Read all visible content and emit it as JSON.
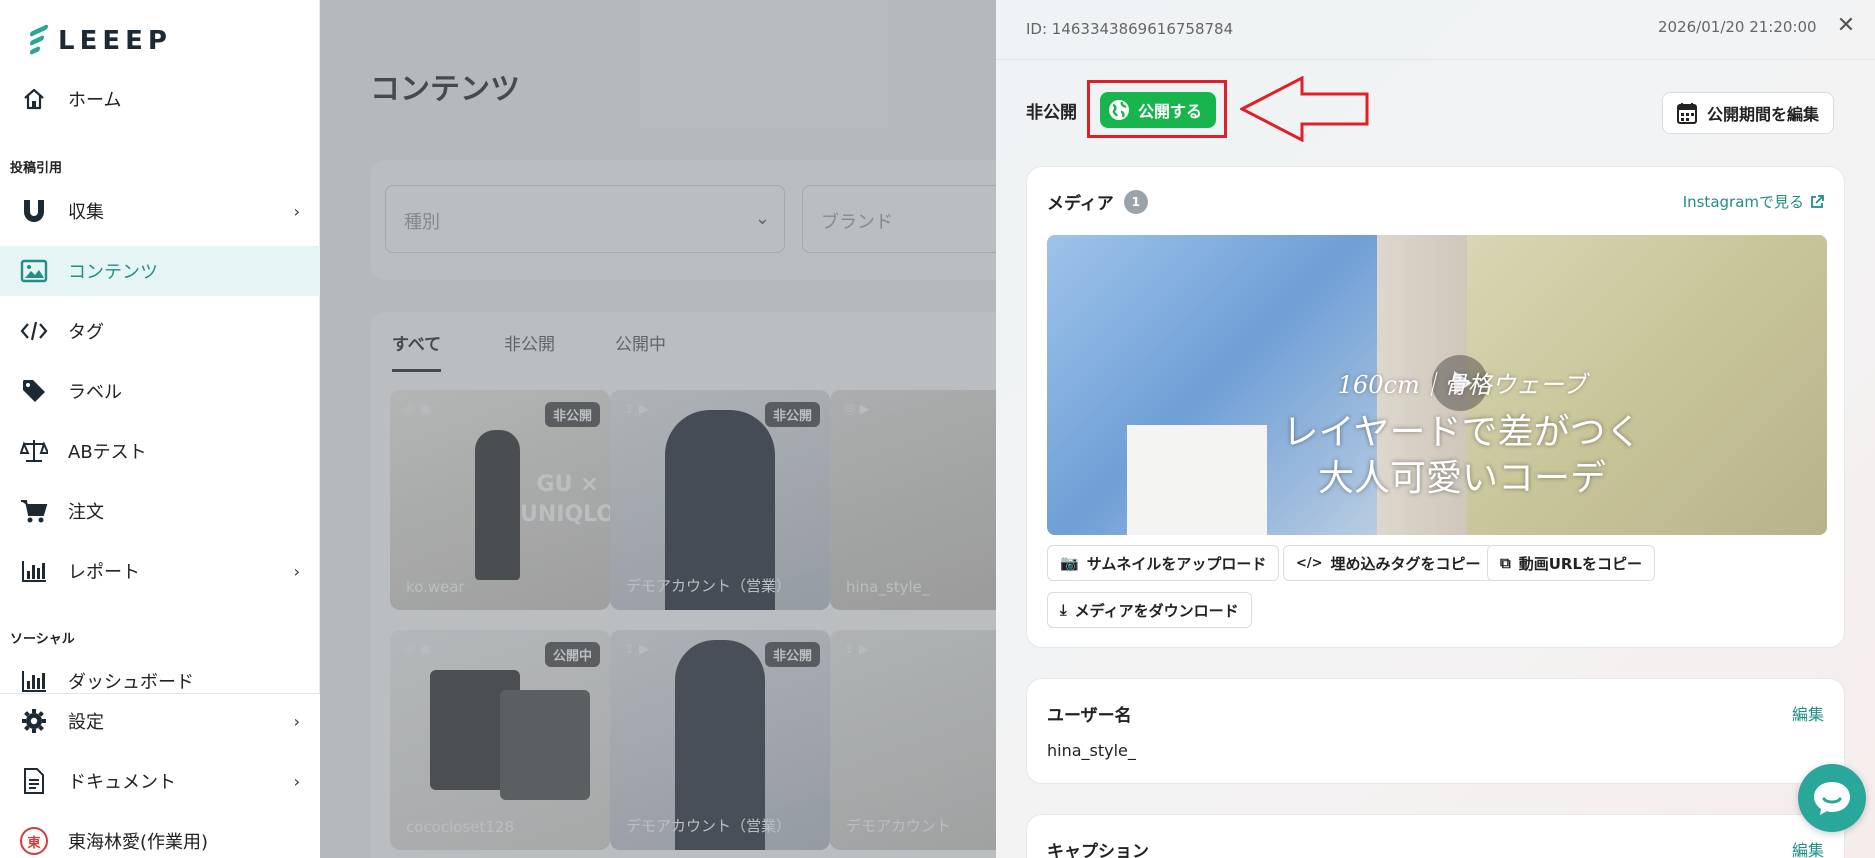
{
  "app": {
    "logo_text": "LEEEP"
  },
  "sidebar": {
    "home": "ホーム",
    "section_posts": "投稿引用",
    "collect": "収集",
    "contents": "コンテンツ",
    "tags": "タグ",
    "labels": "ラベル",
    "abtest": "ABテスト",
    "orders": "注文",
    "reports": "レポート",
    "section_social": "ソーシャル",
    "dashboard": "ダッシュボード",
    "settings": "設定",
    "documents": "ドキュメント",
    "user_initial": "東",
    "user_name": "東海林愛(作業用)"
  },
  "main": {
    "title": "コンテンツ",
    "filter_type_placeholder": "種別",
    "filter_brand_placeholder": "ブランド",
    "tabs": [
      "すべて",
      "非公開",
      "公開中"
    ],
    "tiles": [
      {
        "badge": "非公開",
        "user": "ko.wear",
        "overlay_text": "GU × UNIQLO"
      },
      {
        "badge": "非公開",
        "user": "デモアカウント（営業）"
      },
      {
        "badge": "",
        "user": "hina_style_"
      },
      {
        "badge": "公開中",
        "user": "cococloset128"
      },
      {
        "badge": "非公開",
        "user": "デモアカウント（営業）"
      },
      {
        "badge": "",
        "user": "デモアカウント"
      }
    ]
  },
  "drawer": {
    "id_text": "ID: 1463343869616758784",
    "datetime": "2026/01/20 21:20:00",
    "status_label": "非公開",
    "publish_button": "公開する",
    "edit_period_button": "公開期間を編集",
    "media": {
      "title": "メディア",
      "count": "1",
      "instagram_link": "Instagramで見る",
      "video_caption_small": "160cm｜骨格ウェーブ",
      "video_caption_line1": "レイヤードで差がつく",
      "video_caption_line2": "大人可愛いコーデ",
      "buttons": {
        "upload_thumbnail": "サムネイルをアップロード",
        "copy_embed": "埋め込みタグをコピー",
        "copy_video_url": "動画URLをコピー",
        "download_media": "メディアをダウンロード"
      }
    },
    "username_card": {
      "title": "ユーザー名",
      "edit": "編集",
      "value": "hina_style_"
    },
    "caption_card": {
      "title": "キャプション",
      "edit": "編集"
    }
  },
  "colors": {
    "accent": "#1f8f86",
    "publish_green": "#18b54e",
    "annotation_red": "#e21f26"
  }
}
